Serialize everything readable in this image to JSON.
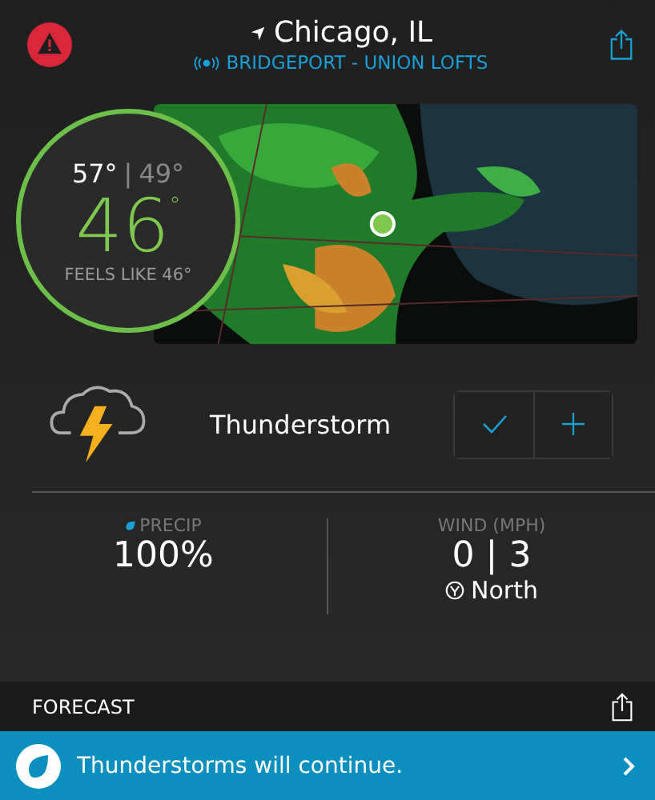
{
  "header": {
    "location": "Chicago, IL",
    "station": "BRIDGEPORT - UNION LOFTS"
  },
  "current": {
    "high": "57°",
    "separator": "|",
    "low": "49°",
    "temperature": "46$^{°}$",
    "feels_like": "FEELS LIKE 46°"
  },
  "condition": {
    "label": "Thunderstorm",
    "buttons": [
      {
        "kind": "check"
      },
      {
        "kind": "add"
      }
    ]
  },
  "stats": [
    {
      "kind": "precip",
      "label": "PRECIP",
      "value": "100%"
    },
    {
      "kind": "wind",
      "label": "WIND (MPH)",
      "value": "0 | 3",
      "direction": "North"
    }
  ],
  "forecast": {
    "title": "FORECAST",
    "message": "Thunderstorms will continue."
  }
}
